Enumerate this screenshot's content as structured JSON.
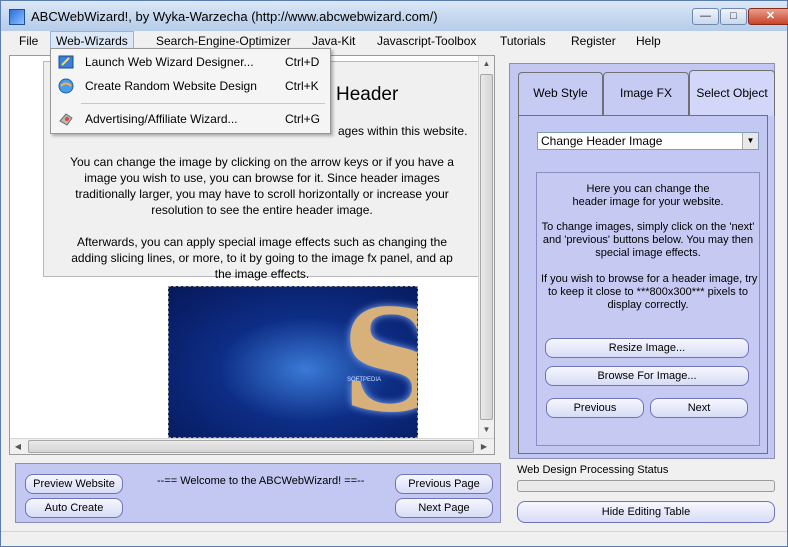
{
  "window": {
    "title": "ABCWebWizard!, by Wyka-Warzecha (http://www.abcwebwizard.com/)",
    "minimize_label": "―",
    "maximize_label": "□",
    "close_label": "✕"
  },
  "menubar": {
    "items": [
      {
        "label": "File"
      },
      {
        "label": "Web-Wizards"
      },
      {
        "label": "Search-Engine-Optimizer"
      },
      {
        "label": "Java-Kit"
      },
      {
        "label": "Javascript-Toolbox"
      },
      {
        "label": "Tutorials"
      },
      {
        "label": "Register"
      },
      {
        "label": "Help"
      }
    ]
  },
  "dropdown": {
    "items": [
      {
        "label": "Launch Web Wizard Designer...",
        "shortcut": "Ctrl+D",
        "icon": "wizard-designer-icon"
      },
      {
        "label": "Create Random Website Design",
        "shortcut": "Ctrl+K",
        "icon": "random-design-icon"
      },
      {
        "label": "Advertising/Affiliate Wizard...",
        "shortcut": "Ctrl+G",
        "icon": "affiliate-wizard-icon"
      }
    ]
  },
  "main": {
    "heading": "Header",
    "line1": "ages within this website.",
    "para1": [
      "You can change the image by clicking on the arrow keys or if you have a",
      "image you wish to use, you can browse for it. Since header images",
      "traditionally larger, you may have to scroll horizontally or increase your",
      "resolution to see the entire header image."
    ],
    "para2": [
      "Afterwards, you can apply special image effects such as changing the",
      "adding slicing lines, or more, to it by going to the image fx panel, and ap",
      "the image effects."
    ],
    "image_letter": "S",
    "image_caption": "SOFTPEDIA"
  },
  "right_panel": {
    "tabs": [
      {
        "label": "Web Style"
      },
      {
        "label": "Image FX"
      },
      {
        "label": "Select Object"
      }
    ],
    "select_value": "Change Header Image",
    "info_lines": [
      "Here you can change the",
      "header image for your website."
    ],
    "change_lines": [
      "To change images, simply click on the 'next'",
      "and 'previous' buttons below. You may then",
      "special image effects."
    ],
    "browse_lines": [
      "If you wish to browse for a header image, try",
      "to keep it close to ***800x300*** pixels to",
      "display correctly."
    ],
    "resize_label": "Resize Image...",
    "browse_label": "Browse For Image...",
    "previous_label": "Previous",
    "next_label": "Next"
  },
  "status": {
    "label": "Web Design Processing Status",
    "progress": 0.0
  },
  "bottom": {
    "preview_label": "Preview Website",
    "auto_create_label": "Auto Create",
    "welcome_text": "--== Welcome to the ABCWebWizard! ==--",
    "previous_page_label": "Previous Page",
    "next_page_label": "Next Page",
    "hide_table_label": "Hide Editing Table"
  }
}
